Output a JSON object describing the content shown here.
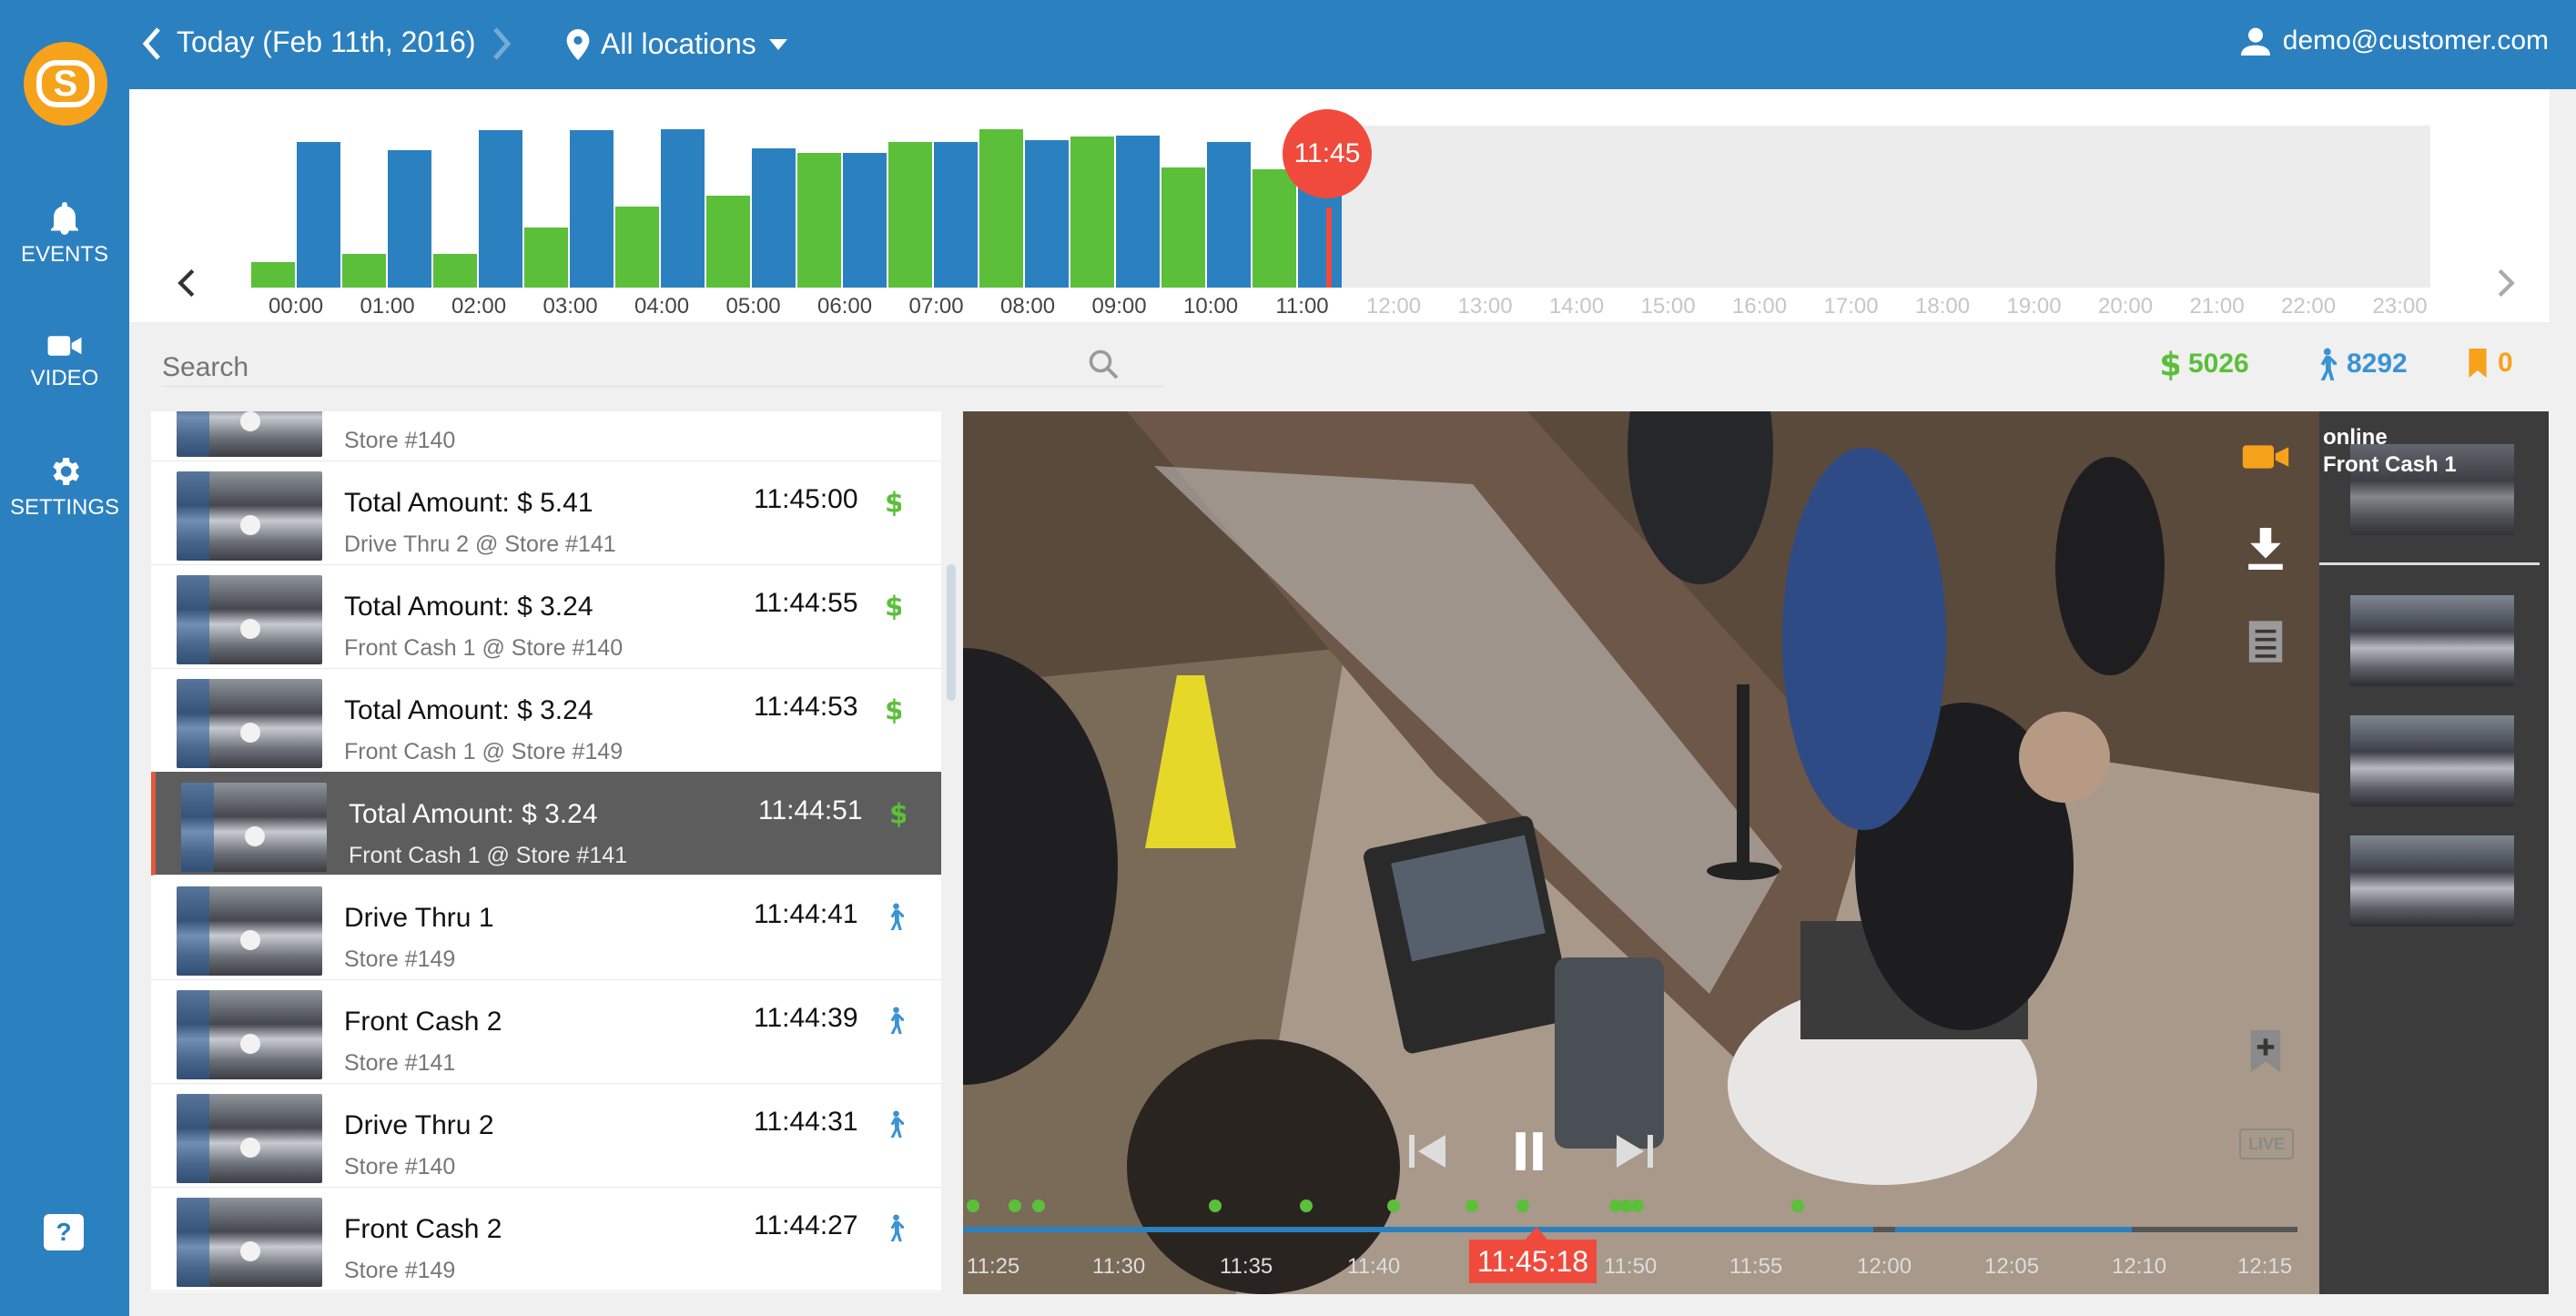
{
  "colors": {
    "brand_blue": "#2b80c0",
    "green": "#5bbf3a",
    "blue_bar": "#2b80c0",
    "marker_red": "#f04a3c",
    "orange": "#f7a21b"
  },
  "sidebar": {
    "logo": "S",
    "items": [
      {
        "label": "EVENTS",
        "icon": "bell-icon"
      },
      {
        "label": "VIDEO",
        "icon": "video-camera-icon"
      },
      {
        "label": "SETTINGS",
        "icon": "gear-icon"
      }
    ],
    "help": "?"
  },
  "header": {
    "date": "Today (Feb 11th, 2016)",
    "location": "All locations",
    "user": "demo@customer.com"
  },
  "timeline": {
    "marker": "11:45",
    "hours": [
      "00:00",
      "01:00",
      "02:00",
      "03:00",
      "04:00",
      "05:00",
      "06:00",
      "07:00",
      "08:00",
      "09:00",
      "10:00",
      "11:00",
      "12:00",
      "13:00",
      "14:00",
      "15:00",
      "16:00",
      "17:00",
      "18:00",
      "19:00",
      "20:00",
      "21:00",
      "22:00",
      "23:00"
    ],
    "bars": [
      {
        "type": "green",
        "level": 0.16
      },
      {
        "type": "blue",
        "level": 0.9
      },
      {
        "type": "green",
        "level": 0.21
      },
      {
        "type": "blue",
        "level": 0.85
      },
      {
        "type": "green",
        "level": 0.21
      },
      {
        "type": "blue",
        "level": 0.97
      },
      {
        "type": "green",
        "level": 0.37
      },
      {
        "type": "blue",
        "level": 0.97
      },
      {
        "type": "green",
        "level": 0.5
      },
      {
        "type": "blue",
        "level": 0.98
      },
      {
        "type": "green",
        "level": 0.57
      },
      {
        "type": "blue",
        "level": 0.86
      },
      {
        "type": "green",
        "level": 0.83
      },
      {
        "type": "blue",
        "level": 0.83
      },
      {
        "type": "green",
        "level": 0.9
      },
      {
        "type": "blue",
        "level": 0.9
      },
      {
        "type": "green",
        "level": 0.98
      },
      {
        "type": "blue",
        "level": 0.91
      },
      {
        "type": "green",
        "level": 0.93
      },
      {
        "type": "blue",
        "level": 0.94
      },
      {
        "type": "green",
        "level": 0.74
      },
      {
        "type": "blue",
        "level": 0.9
      },
      {
        "type": "green",
        "level": 0.73
      },
      {
        "type": "blue",
        "level": 0.78
      }
    ]
  },
  "search": {
    "placeholder": "Search"
  },
  "stats": {
    "money": "5026",
    "people": "8292",
    "bookmarks": "0"
  },
  "events": [
    {
      "title": "",
      "sub": "Store #140",
      "time": "",
      "kind": ""
    },
    {
      "title": "Total Amount: $ 5.41",
      "sub": "Drive Thru 2 @ Store #141",
      "time": "11:45:00",
      "kind": "dollar"
    },
    {
      "title": "Total Amount: $ 3.24",
      "sub": "Front Cash 1 @ Store #140",
      "time": "11:44:55",
      "kind": "dollar"
    },
    {
      "title": "Total Amount: $ 3.24",
      "sub": "Front Cash 1 @ Store #149",
      "time": "11:44:53",
      "kind": "dollar"
    },
    {
      "title": "Total Amount: $ 3.24",
      "sub": "Front Cash 1 @ Store #141",
      "time": "11:44:51",
      "kind": "dollar",
      "selected": true
    },
    {
      "title": "Drive Thru 1",
      "sub": "Store #149",
      "time": "11:44:41",
      "kind": "person"
    },
    {
      "title": "Front Cash 2",
      "sub": "Store #141",
      "time": "11:44:39",
      "kind": "person"
    },
    {
      "title": "Drive Thru 2",
      "sub": "Store #140",
      "time": "11:44:31",
      "kind": "person"
    },
    {
      "title": "Front Cash 2",
      "sub": "Store #149",
      "time": "11:44:27",
      "kind": "person"
    }
  ],
  "video": {
    "current_time": "11:45:18",
    "ticks": [
      "11:25",
      "11:30",
      "11:35",
      "11:40",
      "11:50",
      "11:55",
      "12:00",
      "12:05",
      "12:10",
      "12:15"
    ],
    "live_label": "LIVE"
  },
  "cameras": {
    "status": "online",
    "name": "Front Cash 1"
  }
}
